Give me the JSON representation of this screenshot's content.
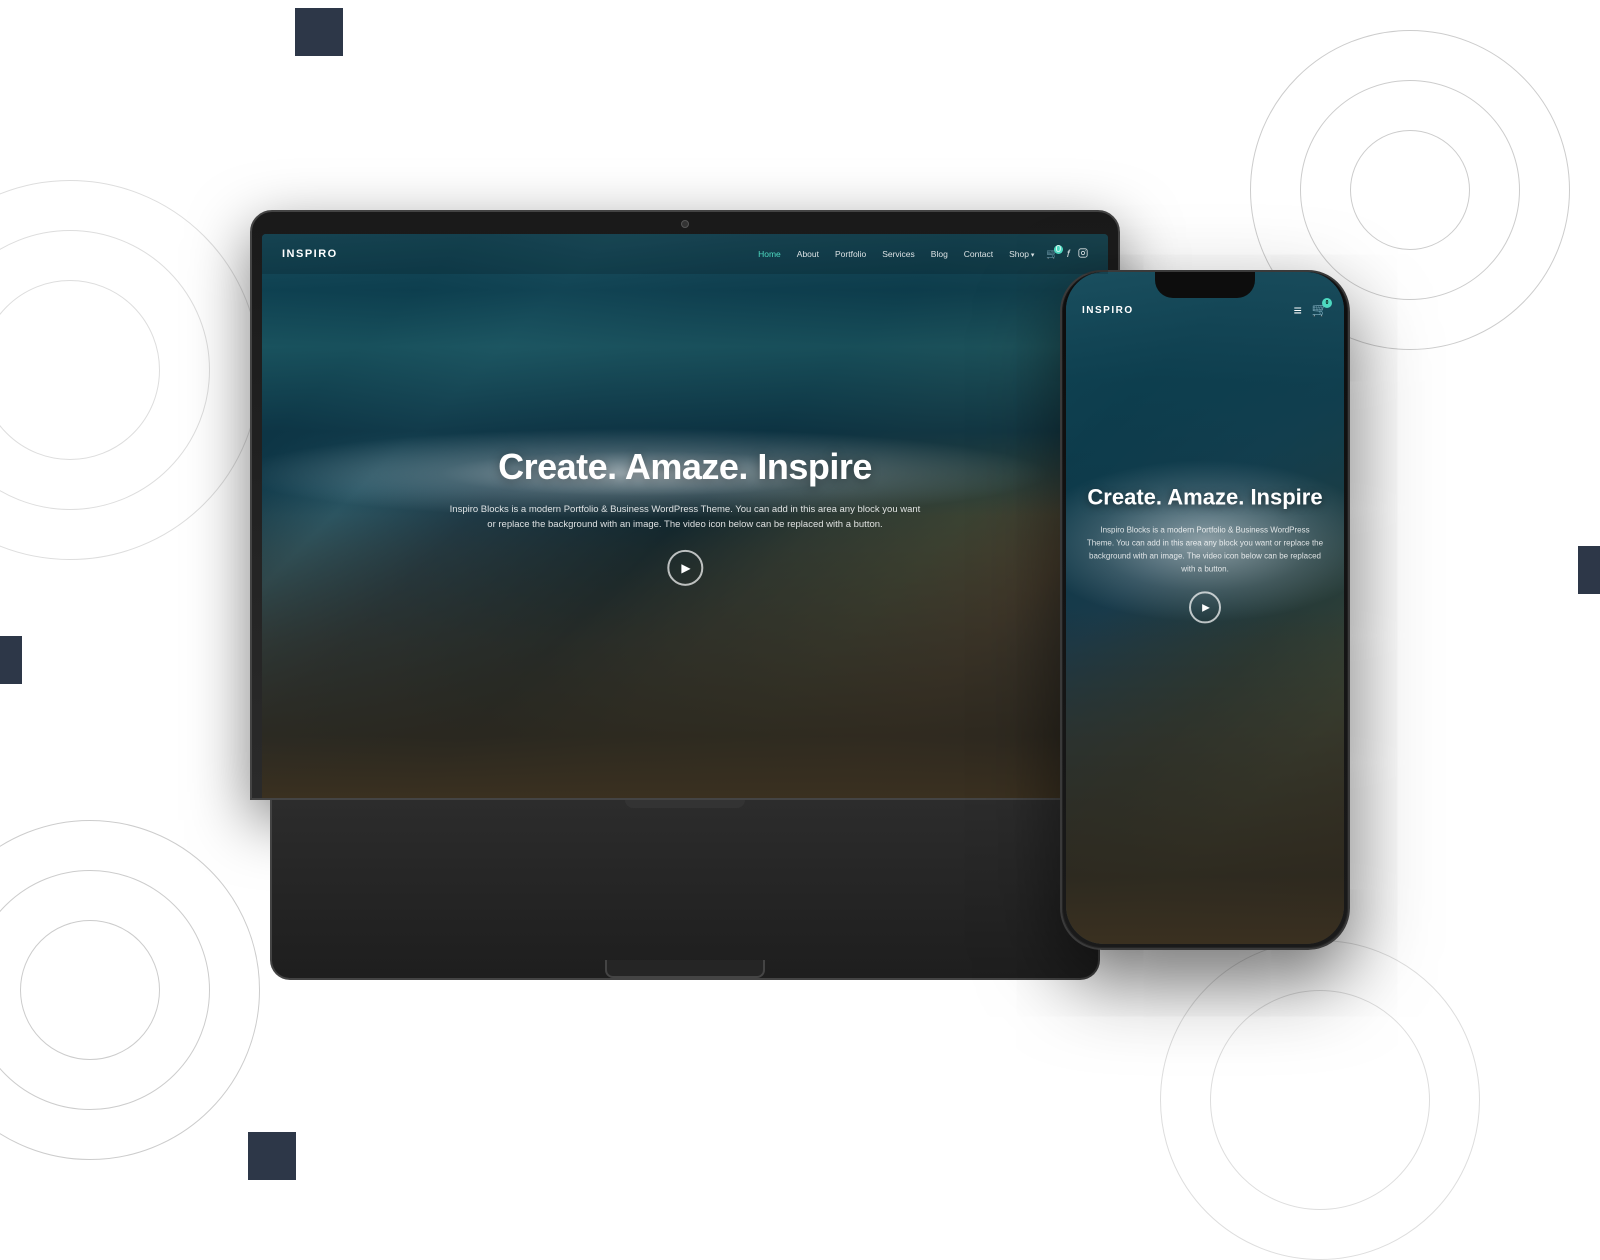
{
  "background": {
    "color": "#ffffff"
  },
  "laptop": {
    "logo": "INSPIRO",
    "nav": {
      "links": [
        {
          "label": "Home",
          "active": true
        },
        {
          "label": "About",
          "active": false
        },
        {
          "label": "Portfolio",
          "active": false
        },
        {
          "label": "Services",
          "active": false
        },
        {
          "label": "Blog",
          "active": false
        },
        {
          "label": "Contact",
          "active": false
        },
        {
          "label": "Shop",
          "active": false,
          "dropdown": true
        }
      ]
    },
    "hero": {
      "title": "Create. Amaze. Inspire",
      "subtitle": "Inspiro Blocks is a modern Portfolio & Business WordPress Theme. You can add in this area any block you want or replace the background with an image. The video icon below can be replaced with a button."
    }
  },
  "phone": {
    "logo": "INSPIRO",
    "hero": {
      "title": "Create. Amaze. Inspire",
      "subtitle": "Inspiro Blocks is a modern Portfolio & Business WordPress Theme. You can add in this area any block you want or replace the background with an image. The video icon below can be replaced with a button."
    }
  },
  "decorative": {
    "squares": [
      "top-right-corner",
      "left-middle",
      "right-middle",
      "bottom-left"
    ]
  }
}
